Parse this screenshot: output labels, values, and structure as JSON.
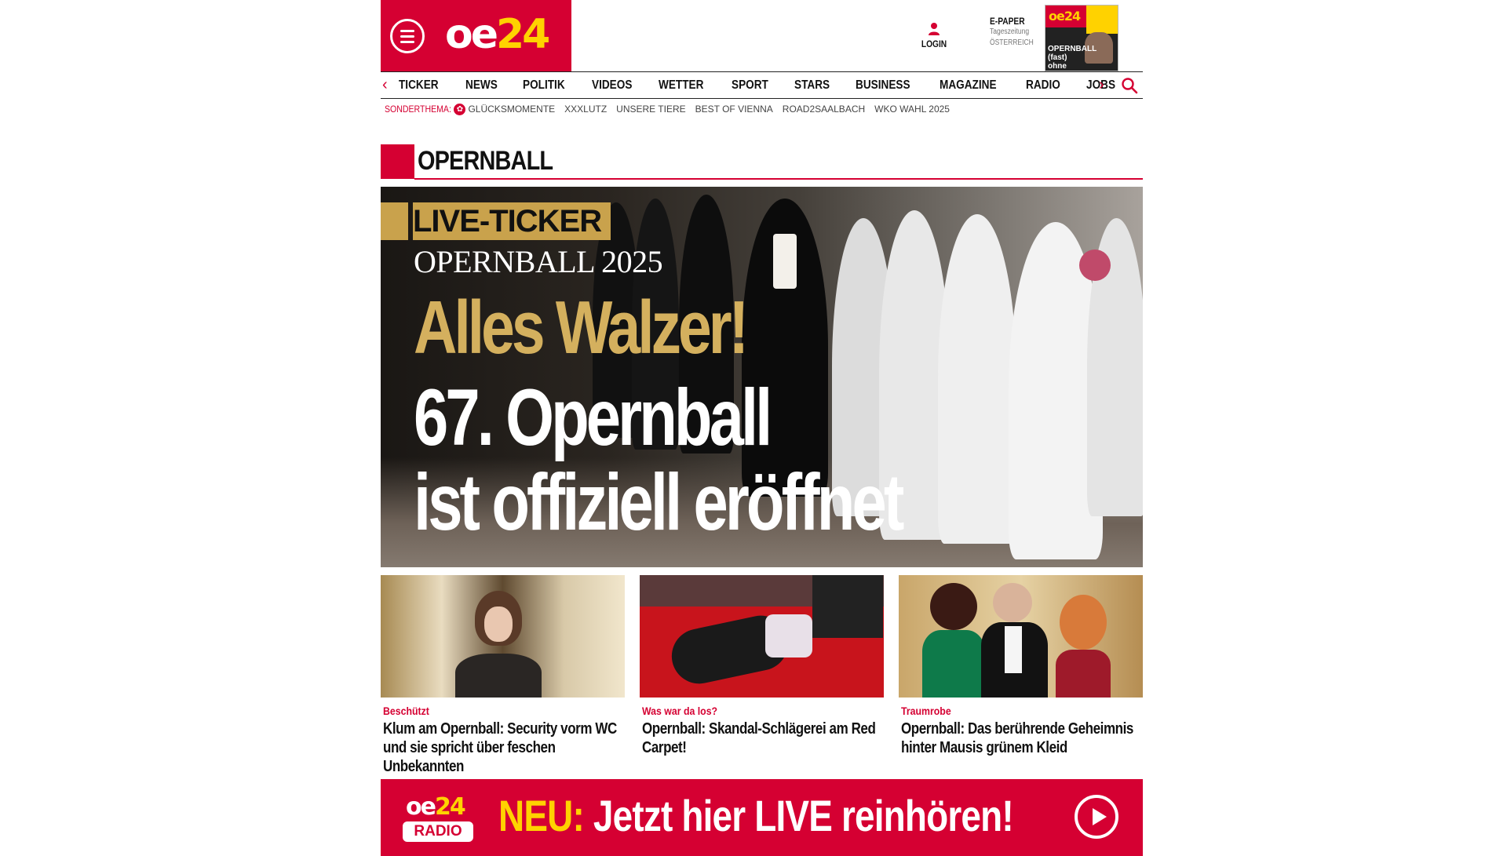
{
  "brand": {
    "logo_oe": "oe",
    "logo_num": "24",
    "accent": "#d50032",
    "gold": "#ffd200"
  },
  "header": {
    "login_label": "LOGIN",
    "epaper": {
      "title": "E-PAPER",
      "sub1": "Tageszeitung",
      "sub2": "ÖSTERREICH",
      "cover_logo": "oe24",
      "cover_text": "OPERNBALL (fast) ohne Stars"
    }
  },
  "nav": {
    "items": [
      "TICKER",
      "NEWS",
      "POLITIK",
      "VIDEOS",
      "WETTER",
      "SPORT",
      "STARS",
      "BUSINESS",
      "MAGAZINE",
      "RADIO",
      "JOBS"
    ],
    "left_arrow": "‹",
    "right_arrow": "›"
  },
  "subnav": {
    "label": "SONDERTHEMA:",
    "badge": "✿",
    "links": [
      "GLÜCKSMOMENTE",
      "XXXLUTZ",
      "UNSERE TIERE",
      "BEST OF VIENNA",
      "ROAD2SAALBACH",
      "WKO WAHL 2025"
    ]
  },
  "section": {
    "title": "OPERNBALL"
  },
  "hero": {
    "badge": "LIVE-TICKER",
    "kicker": "OPERNBALL 2025",
    "headline_gold": "Alles Walzer!",
    "headline_line1": "67. Opernball",
    "headline_line2": "ist offiziell eröffnet"
  },
  "cards": [
    {
      "kicker": "Beschützt",
      "headline": "Klum am Opernball: Security vorm WC und sie spricht über feschen Unbekannten"
    },
    {
      "kicker": "Was war da los?",
      "headline": "Opernball: Skandal-Schlägerei am Red Carpet!"
    },
    {
      "kicker": "Traumrobe",
      "headline": "Opernball: Das berührende Geheimnis hinter Mausis grünem Kleid"
    }
  ],
  "radio": {
    "logo_oe": "oe",
    "logo_num": "24",
    "tag": "RADIO",
    "neu": "NEU:",
    "text": " Jetzt hier LIVE reinhören!"
  }
}
